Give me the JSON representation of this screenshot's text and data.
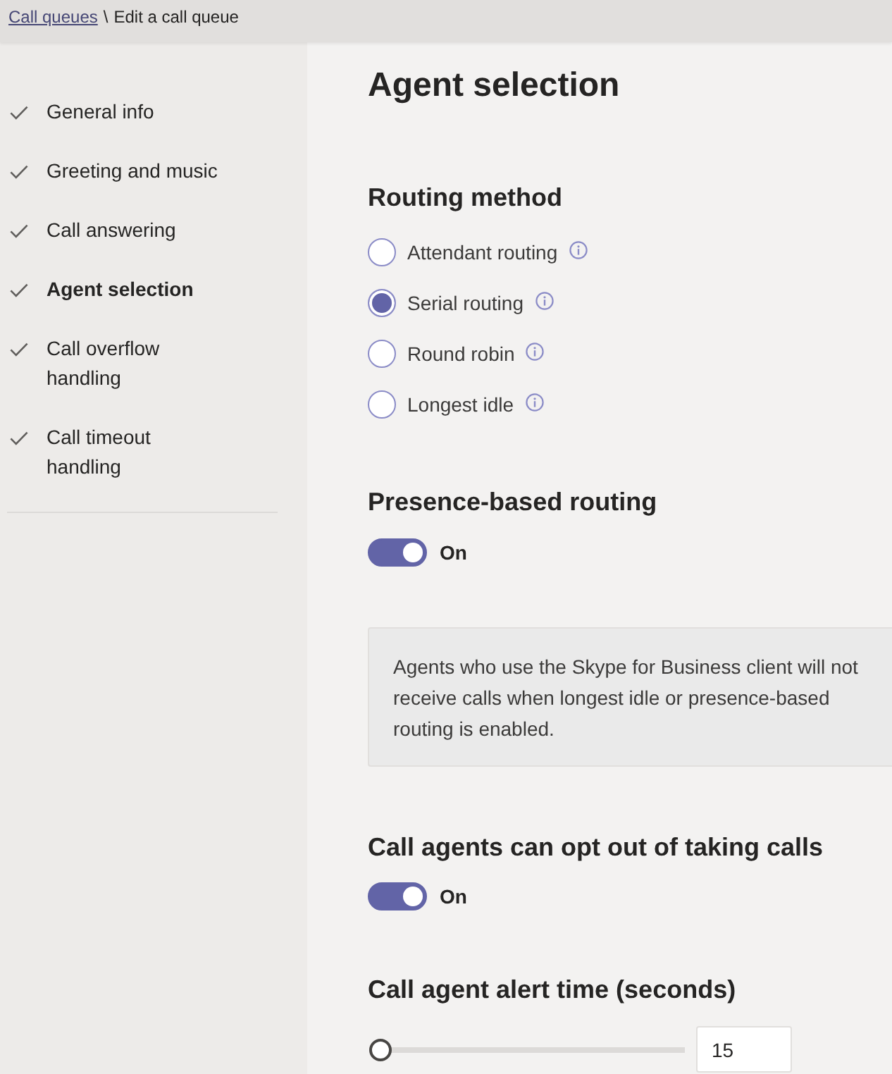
{
  "breadcrumb": {
    "link": "Call queues",
    "separator": "\\",
    "current": "Edit a call queue"
  },
  "sidebar": {
    "items": [
      {
        "label": "General info",
        "completed": true,
        "selected": false
      },
      {
        "label": "Greeting and music",
        "completed": true,
        "selected": false
      },
      {
        "label": "Call answering",
        "completed": true,
        "selected": false
      },
      {
        "label": "Agent selection",
        "completed": true,
        "selected": true
      },
      {
        "label": "Call overflow handling",
        "completed": true,
        "selected": false
      },
      {
        "label": "Call timeout handling",
        "completed": true,
        "selected": false
      }
    ]
  },
  "main": {
    "title": "Agent selection",
    "routing_method": {
      "heading": "Routing method",
      "options": [
        {
          "label": "Attendant routing",
          "selected": false
        },
        {
          "label": "Serial routing",
          "selected": true
        },
        {
          "label": "Round robin",
          "selected": false
        },
        {
          "label": "Longest idle",
          "selected": false
        }
      ]
    },
    "presence_routing": {
      "heading": "Presence-based routing",
      "toggle": {
        "on": true,
        "label": "On"
      }
    },
    "notice": "Agents who use the Skype for Business client will not receive calls when longest idle or presence-based routing is enabled.",
    "opt_out": {
      "heading": "Call agents can opt out of taking calls",
      "toggle": {
        "on": true,
        "label": "On"
      }
    },
    "alert_time": {
      "heading": "Call agent alert time (seconds)",
      "slider": {
        "level": 0
      },
      "value": "15"
    }
  }
}
